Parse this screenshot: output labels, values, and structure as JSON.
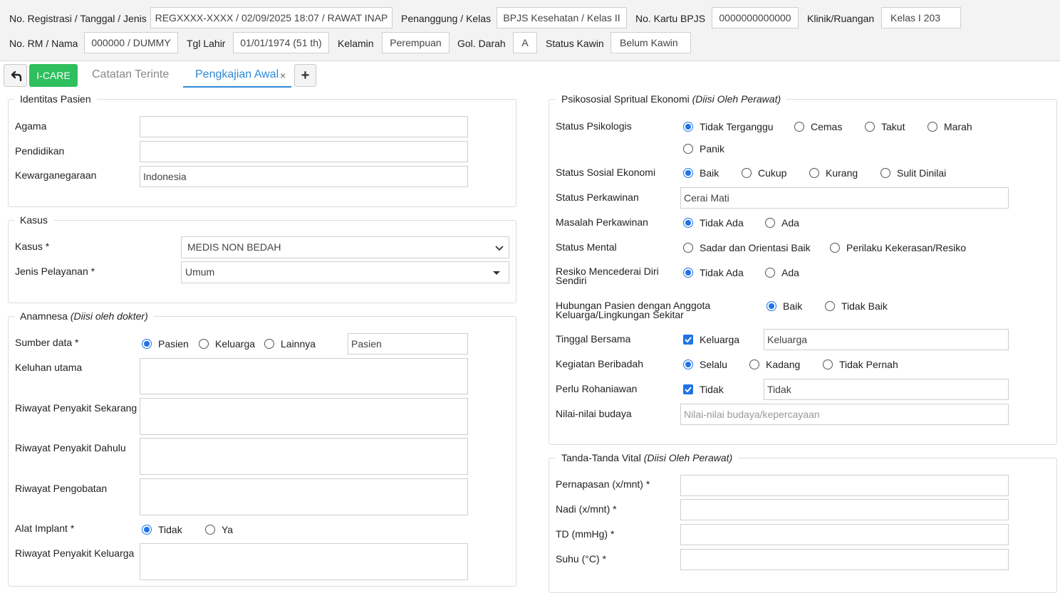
{
  "header": {
    "registrasi_label": "No. Registrasi / Tanggal / Jenis",
    "registrasi_value": "REGXXXX-XXXX / 02/09/2025 18:07 / RAWAT INAP",
    "penanggung_label": "Penanggung / Kelas",
    "penanggung_value": "BPJS Kesehatan / Kelas II",
    "kartu_label": "No. Kartu BPJS",
    "kartu_value": "0000000000000",
    "klinik_label": "Klinik/Ruangan",
    "klinik_value": "Kelas I 203",
    "rm_label": "No. RM / Nama",
    "rm_value": "000000 / DUMMY",
    "lahir_label": "Tgl Lahir",
    "lahir_value": "01/01/1974 (51 th)",
    "kelamin_label": "Kelamin",
    "kelamin_value": "Perempuan",
    "darah_label": "Gol. Darah",
    "darah_value": "A",
    "kawin_label": "Status Kawin",
    "kawin_value": "Belum Kawin"
  },
  "tabs": {
    "icare": "I-CARE",
    "catatan": "Catatan Terinte",
    "pengkajian": "Pengkajian Awal",
    "close": "×",
    "add": "+"
  },
  "identitas": {
    "legend": "Identitas Pasien",
    "agama_label": "Agama",
    "agama_value": "",
    "pendidikan_label": "Pendidikan",
    "pendidikan_value": "",
    "kwn_label": "Kewarganegaraan",
    "kwn_value": "Indonesia"
  },
  "kasus": {
    "legend": "Kasus",
    "kasus_label": "Kasus *",
    "kasus_value": "MEDIS NON BEDAH",
    "jenis_label": "Jenis Pelayanan *",
    "jenis_value": "Umum"
  },
  "anamnesa": {
    "legend": "Anamnesa",
    "legend_note": "(Diisi oleh dokter)",
    "sumber_label": "Sumber data *",
    "sumber_options": [
      "Pasien",
      "Keluarga",
      "Lainnya"
    ],
    "sumber_value": "Pasien",
    "keluhan_label": "Keluhan utama",
    "rps_label": "Riwayat Penyakit Sekarang",
    "rpd_label": "Riwayat Penyakit Dahulu",
    "pengobatan_label": "Riwayat Pengobatan",
    "implant_label": "Alat Implant *",
    "implant_options": [
      "Tidak",
      "Ya"
    ],
    "rpk_label": "Riwayat Penyakit Keluarga"
  },
  "psiko": {
    "legend": "Psikososial Spritual Ekonomi",
    "legend_note": "(Diisi Oleh Perawat)",
    "psikologis_label": "Status Psikologis",
    "psikologis_options": [
      "Tidak Terganggu",
      "Cemas",
      "Takut",
      "Marah",
      "Panik"
    ],
    "sosek_label": "Status Sosial Ekonomi",
    "sosek_options": [
      "Baik",
      "Cukup",
      "Kurang",
      "Sulit Dinilai"
    ],
    "perkawinan_label": "Status Perkawinan",
    "perkawinan_value": "Cerai Mati",
    "masalah_label": "Masalah Perkawinan",
    "masalah_options": [
      "Tidak Ada",
      "Ada"
    ],
    "mental_label": "Status Mental",
    "mental_options": [
      "Sadar dan Orientasi Baik",
      "Perilaku Kekerasan/Resiko"
    ],
    "resiko_label": "Resiko Mencederai Diri Sendiri",
    "resiko_options": [
      "Tidak Ada",
      "Ada"
    ],
    "hubungan_label": "Hubungan Pasien dengan Anggota Keluarga/Lingkungan Sekitar",
    "hubungan_options": [
      "Baik",
      "Tidak Baik"
    ],
    "tinggal_label": "Tinggal Bersama",
    "tinggal_check": "Keluarga",
    "tinggal_value": "Keluarga",
    "ibadah_label": "Kegiatan Beribadah",
    "ibadah_options": [
      "Selalu",
      "Kadang",
      "Tidak Pernah"
    ],
    "rohaniawan_label": "Perlu Rohaniawan",
    "rohaniawan_check": "Tidak",
    "rohaniawan_value": "Tidak",
    "budaya_label": "Nilai-nilai budaya",
    "budaya_placeholder": "Nilai-nilai budaya/kepercayaan"
  },
  "vital": {
    "legend": "Tanda-Tanda Vital",
    "legend_note": "(Diisi Oleh Perawat)",
    "napas_label": "Pernapasan (x/mnt) *",
    "nadi_label": "Nadi (x/mnt) *",
    "td_label": "TD (mmHg) *",
    "suhu_label": "Suhu (°C) *"
  },
  "colors": {
    "accent": "#2e88d6",
    "icare_green": "#2fbf5e",
    "radio_blue": "#1f73e6"
  }
}
